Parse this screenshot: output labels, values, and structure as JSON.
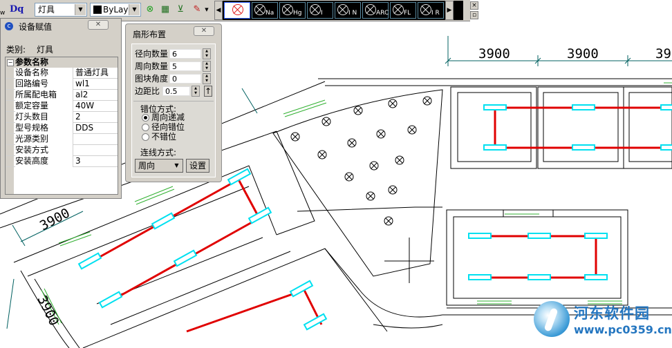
{
  "toolbar": {
    "logo_text": "Dq",
    "symbol_combo": "灯具",
    "layer_combo": "ByLaye",
    "symbols": [
      {
        "name": "",
        "selected": true
      },
      {
        "name": "Na",
        "selected": false
      },
      {
        "name": "Hg",
        "selected": false
      },
      {
        "name": "I",
        "selected": false
      },
      {
        "name": "I N",
        "selected": false
      },
      {
        "name": "ARC",
        "selected": false
      },
      {
        "name": "FL",
        "selected": false
      },
      {
        "name": "I R",
        "selected": false
      }
    ],
    "scroll_left": "◀",
    "scroll_right": "▶",
    "win_close": "×",
    "left_edge_text": "w"
  },
  "properties_panel": {
    "title": "设备赋值",
    "close_label": "✕",
    "category_label": "类别:",
    "category_value": "灯具",
    "group_header": "参数名称",
    "group_toggle": "−",
    "rows": [
      {
        "key": "设备名称",
        "value": "普通灯具"
      },
      {
        "key": "回路编号",
        "value": "wl1"
      },
      {
        "key": "所属配电箱",
        "value": "al2"
      },
      {
        "key": "额定容量",
        "value": "40W"
      },
      {
        "key": "灯头数目",
        "value": "2"
      },
      {
        "key": "型号规格",
        "value": "DDS"
      },
      {
        "key": "光源类别",
        "value": ""
      },
      {
        "key": "安装方式",
        "value": ""
      },
      {
        "key": "安装高度",
        "value": "3"
      }
    ]
  },
  "fan_dialog": {
    "title": "扇形布置",
    "close_label": "✕",
    "radial_count_label": "径向数量",
    "radial_count": "6",
    "circ_count_label": "周向数量",
    "circ_count": "5",
    "block_angle_label": "图块角度",
    "block_angle": "0",
    "edge_ratio_label": "边距比",
    "edge_ratio": "0.5",
    "pick_button": "↑",
    "stagger_label": "错位方式:",
    "stagger_options": [
      {
        "label": "周向递减",
        "checked": true
      },
      {
        "label": "径向错位",
        "checked": false
      },
      {
        "label": "不错位",
        "checked": false
      }
    ],
    "connect_label": "连线方式:",
    "connect_value": "周向",
    "settings_button": "设置"
  },
  "drawing": {
    "dimension_labels": [
      "3900",
      "3900",
      "39",
      "3900",
      "3900"
    ],
    "colors": {
      "wall": "#000000",
      "fixture": "#00e0f0",
      "wire": "#e00000",
      "window": "#30b030",
      "dim": "#006060"
    }
  },
  "watermark": {
    "title": "河东软件园",
    "url": "www.pc0359.cn"
  }
}
